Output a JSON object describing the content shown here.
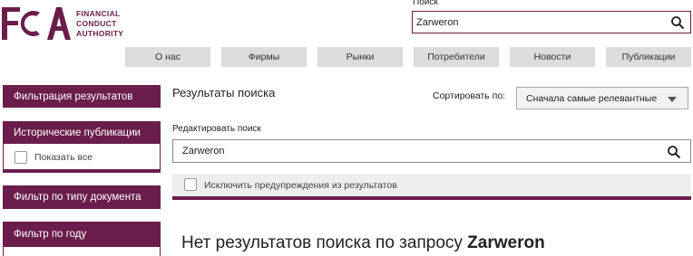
{
  "brand": {
    "logo_letters": "FCA",
    "name_line1": "FINANCIAL",
    "name_line2": "CONDUCT",
    "name_line3": "AUTHORITY",
    "color": "#6b1d4b"
  },
  "header_search": {
    "label": "Поиск",
    "value": "Zarweron",
    "icon": "search-icon"
  },
  "nav": {
    "items": [
      "О нас",
      "Фирмы",
      "Рынки",
      "Потребители",
      "Новости",
      "Публикации"
    ]
  },
  "sidebar": {
    "filter_title": "Фильтрация результатов",
    "historic_title": "Исторические публикации",
    "show_all_label": "Показать все",
    "doc_type_title": "Фильтр по типу документа",
    "year_title": "Фильтр по году"
  },
  "main": {
    "results_title": "Результаты поиска",
    "sort_label": "Сортировать по:",
    "sort_value": "Сначала самые релевантные",
    "edit_label": "Редактировать поиск",
    "edit_value": "Zarweron",
    "exclude_label": "Исключить предупреждения из результатов",
    "no_results_prefix": "Нет результатов поиска по запросу",
    "no_results_query": "Zarweron"
  }
}
